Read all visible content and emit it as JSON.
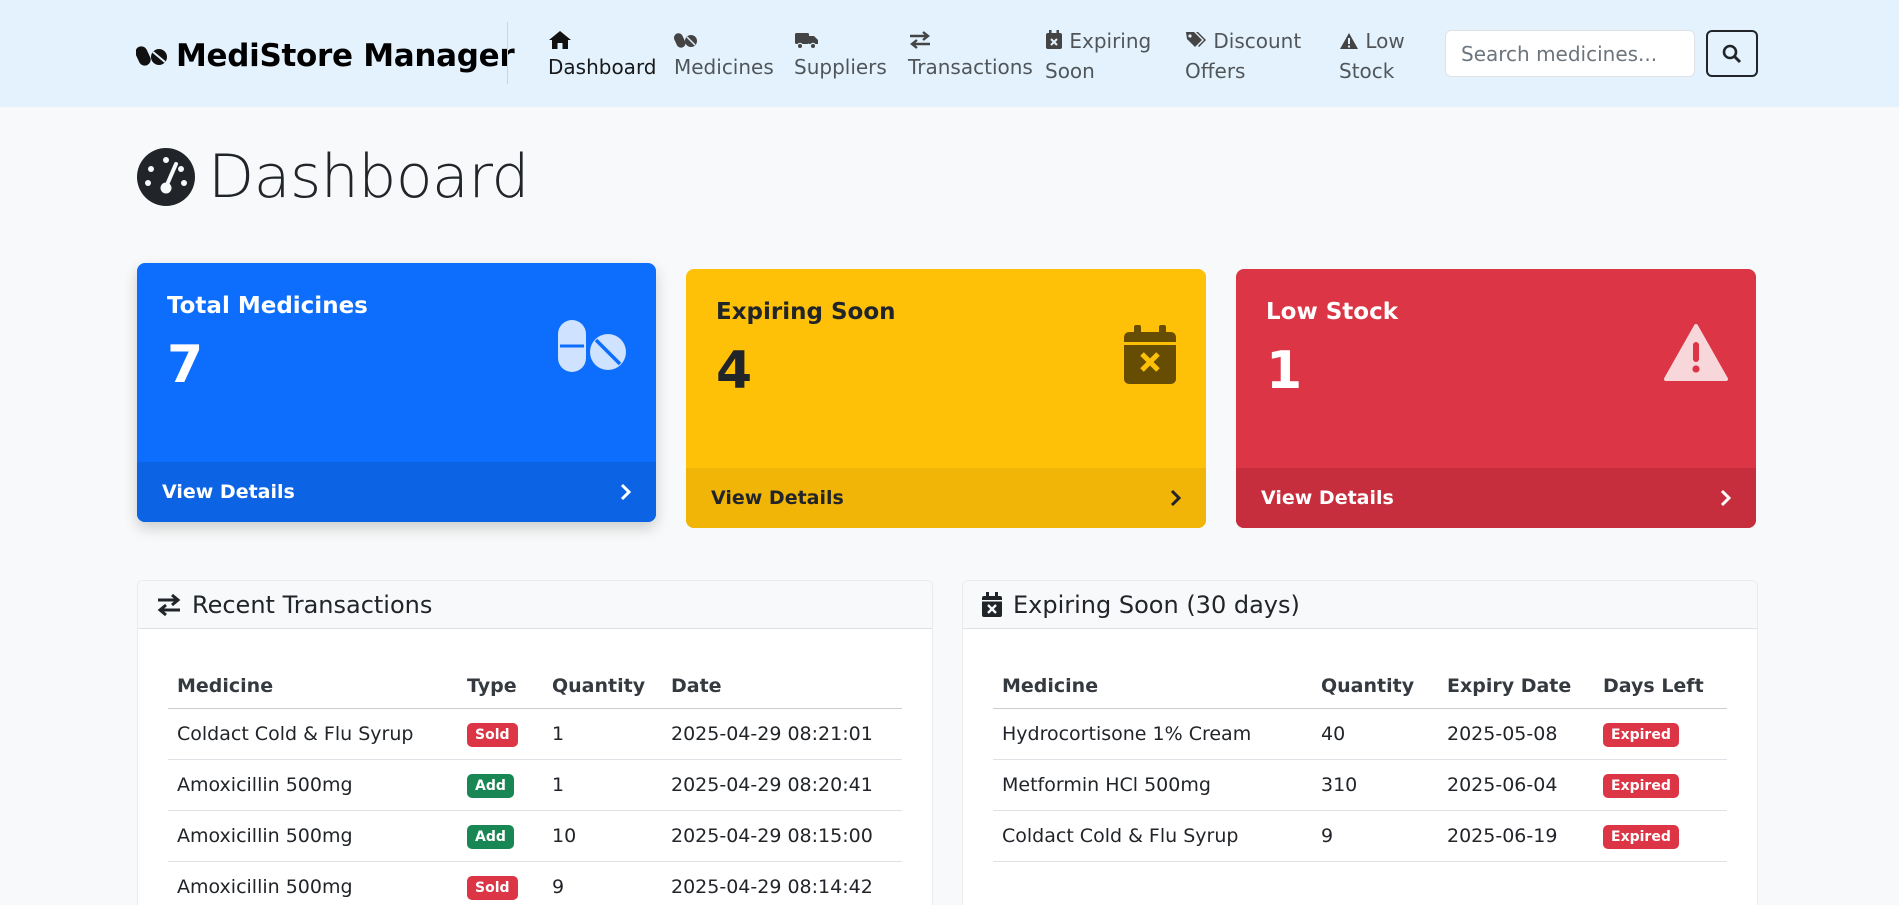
{
  "brand": {
    "name": "MediStore Manager"
  },
  "nav": {
    "items": [
      {
        "label": "Dashboard",
        "icon": "home-icon",
        "active": true
      },
      {
        "label": "Medicines",
        "icon": "pills-icon"
      },
      {
        "label": "Suppliers",
        "icon": "truck-icon"
      },
      {
        "label": "Transactions",
        "icon": "exchange-icon"
      },
      {
        "label_line1": "Expiring",
        "label_line2": "Soon",
        "icon": "calendar-x-icon"
      },
      {
        "label_line1": "Discount",
        "label_line2": "Offers",
        "icon": "tags-icon"
      },
      {
        "label_line1": "Low",
        "label_line2": "Stock",
        "icon": "warning-icon"
      }
    ]
  },
  "search": {
    "placeholder": "Search medicines..."
  },
  "page": {
    "title": "Dashboard"
  },
  "cards": {
    "total": {
      "label": "Total Medicines",
      "value": "7",
      "footer": "View Details",
      "color": "#0d6efd"
    },
    "expiring": {
      "label": "Expiring Soon",
      "value": "4",
      "footer": "View Details",
      "color": "#ffc107"
    },
    "low": {
      "label": "Low Stock",
      "value": "1",
      "footer": "View Details",
      "color": "#dc3545"
    }
  },
  "transactions": {
    "title": "Recent Transactions",
    "headers": {
      "medicine": "Medicine",
      "type": "Type",
      "quantity": "Quantity",
      "date": "Date"
    },
    "rows": [
      {
        "medicine": "Coldact Cold & Flu Syrup",
        "type": "Sold",
        "quantity": "1",
        "date": "2025-04-29 08:21:01"
      },
      {
        "medicine": "Amoxicillin 500mg",
        "type": "Add",
        "quantity": "1",
        "date": "2025-04-29 08:20:41"
      },
      {
        "medicine": "Amoxicillin 500mg",
        "type": "Add",
        "quantity": "10",
        "date": "2025-04-29 08:15:00"
      },
      {
        "medicine": "Amoxicillin 500mg",
        "type": "Sold",
        "quantity": "9",
        "date": "2025-04-29 08:14:42"
      }
    ]
  },
  "expiring": {
    "title": "Expiring Soon (30 days)",
    "headers": {
      "medicine": "Medicine",
      "quantity": "Quantity",
      "expiry": "Expiry Date",
      "days": "Days Left"
    },
    "rows": [
      {
        "medicine": "Hydrocortisone 1% Cream",
        "quantity": "40",
        "expiry": "2025-05-08",
        "days": "Expired"
      },
      {
        "medicine": "Metformin HCl 500mg",
        "quantity": "310",
        "expiry": "2025-06-04",
        "days": "Expired"
      },
      {
        "medicine": "Coldact Cold & Flu Syrup",
        "quantity": "9",
        "expiry": "2025-06-19",
        "days": "Expired"
      }
    ]
  }
}
